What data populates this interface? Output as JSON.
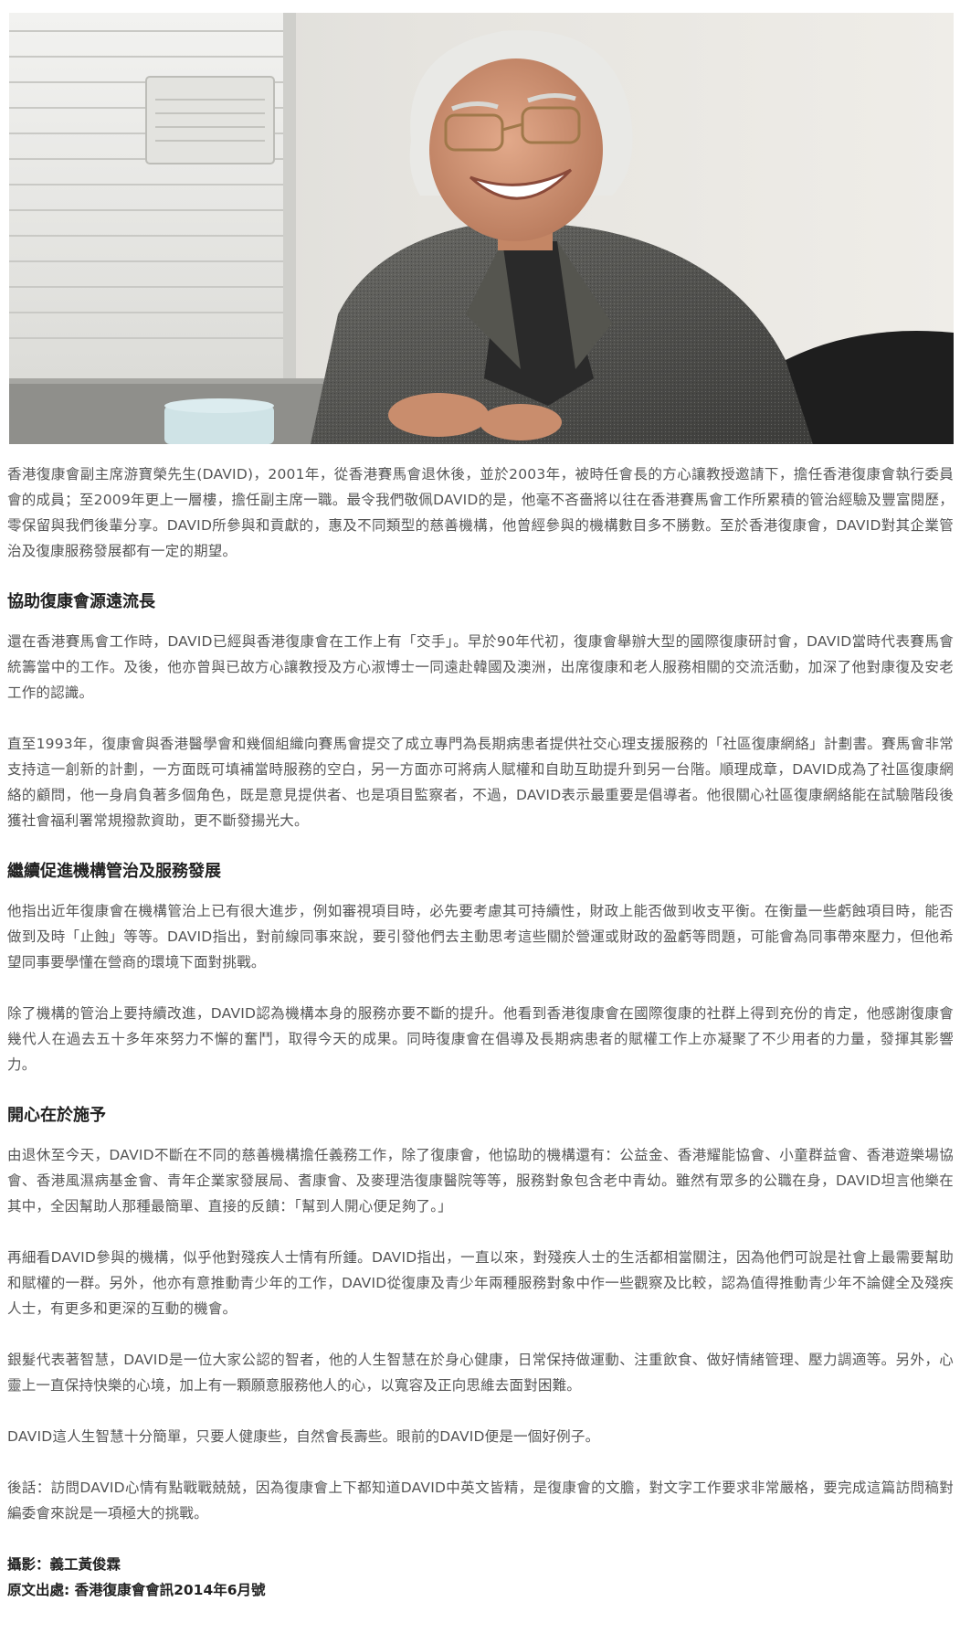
{
  "photo": {
    "alt": ""
  },
  "intro": "香港復康會副主席游寶榮先生(DAVID)，2001年，從香港賽馬會退休後，並於2003年，被時任會長的方心讓教授邀請下，擔任香港復康會執行委員會的成員；至2009年更上一層樓，擔任副主席一職。最令我們敬佩DAVID的是，他毫不吝嗇將以往在香港賽馬會工作所累積的管治經驗及豐富閱歷，零保留與我們後輩分享。DAVID所參與和貢獻的，惠及不同類型的慈善機構，他曾經參與的機構數目多不勝數。至於香港復康會，DAVID對其企業管治及復康服務發展都有一定的期望。",
  "sections": [
    {
      "heading": "協助復康會源遠流長",
      "paragraphs": [
        "還在香港賽馬會工作時，DAVID已經與香港復康會在工作上有「交手」。早於90年代初，復康會舉辦大型的國際復康研討會，DAVID當時代表賽馬會統籌當中的工作。及後，他亦曾與已故方心讓教授及方心淑博士一同遠赴韓國及澳洲，出席復康和老人服務相關的交流活動，加深了他對康復及安老工作的認識。",
        "直至1993年，復康會與香港醫學會和幾個組織向賽馬會提交了成立專門為長期病患者提供社交心理支援服務的「社區復康網絡」計劃書。賽馬會非常支持這一創新的計劃，一方面既可填補當時服務的空白，另一方面亦可將病人賦權和自助互助提升到另一台階。順理成章，DAVID成為了社區復康網絡的顧問，他一身肩負著多個角色，既是意見提供者、也是項目監察者，不過，DAVID表示最重要是倡導者。他很關心社區復康網絡能在試驗階段後獲社會福利署常規撥款資助，更不斷發揚光大。"
      ]
    },
    {
      "heading": "繼續促進機構管治及服務發展",
      "paragraphs": [
        "他指出近年復康會在機構管治上已有很大進步，例如審視項目時，必先要考慮其可持續性，財政上能否做到收支平衡。在衡量一些虧蝕項目時，能否做到及時「止蝕」等等。DAVID指出，對前線同事來說，要引發他們去主動思考這些關於營運或財政的盈虧等問題，可能會為同事帶來壓力，但他希望同事要學懂在營商的環境下面對挑戰。",
        "除了機構的管治上要持續改進，DAVID認為機構本身的服務亦要不斷的提升。他看到香港復康會在國際復康的社群上得到充份的肯定，他感謝復康會幾代人在過去五十多年來努力不懈的奮鬥，取得今天的成果。同時復康會在倡導及長期病患者的賦權工作上亦凝聚了不少用者的力量，發揮其影響力。"
      ]
    },
    {
      "heading": "開心在於施予",
      "paragraphs": [
        "由退休至今天，DAVID不斷在不同的慈善機構擔任義務工作，除了復康會，他協助的機構還有：公益金、香港耀能協會、小童群益會、香港遊樂場協會、香港風濕病基金會、青年企業家發展局、耆康會、及麥理浩復康醫院等等，服務對象包含老中青幼。雖然有眾多的公職在身，DAVID坦言他樂在其中，全因幫助人那種最簡單、直接的反饋：「幫到人開心便足夠了。」",
        "再細看DAVID參與的機構，似乎他對殘疾人士情有所鍾。DAVID指出，一直以來，對殘疾人士的生活都相當關注，因為他們可說是社會上最需要幫助和賦權的一群。另外，他亦有意推動青少年的工作，DAVID從復康及青少年兩種服務對象中作一些觀察及比較，認為值得推動青少年不論健全及殘疾人士，有更多和更深的互動的機會。",
        "銀髮代表著智慧，DAVID是一位大家公認的智者，他的人生智慧在於身心健康，日常保持做運動、注重飲食、做好情緒管理、壓力調適等。另外，心靈上一直保持快樂的心境，加上有一顆願意服務他人的心，以寬容及正向思維去面對困難。",
        "DAVID這人生智慧十分簡單，只要人健康些，自然會長壽些。眼前的DAVID便是一個好例子。",
        "後話：訪問DAVID心情有點戰戰兢兢，因為復康會上下都知道DAVID中英文皆精，是復康會的文膽，對文字工作要求非常嚴格，要完成這篇訪問稿對編委會來說是一項極大的挑戰。"
      ]
    }
  ],
  "credits": {
    "photographer": "攝影：義工黃俊霖",
    "source": "原文出處: 香港復康會會訊2014年6月號"
  }
}
